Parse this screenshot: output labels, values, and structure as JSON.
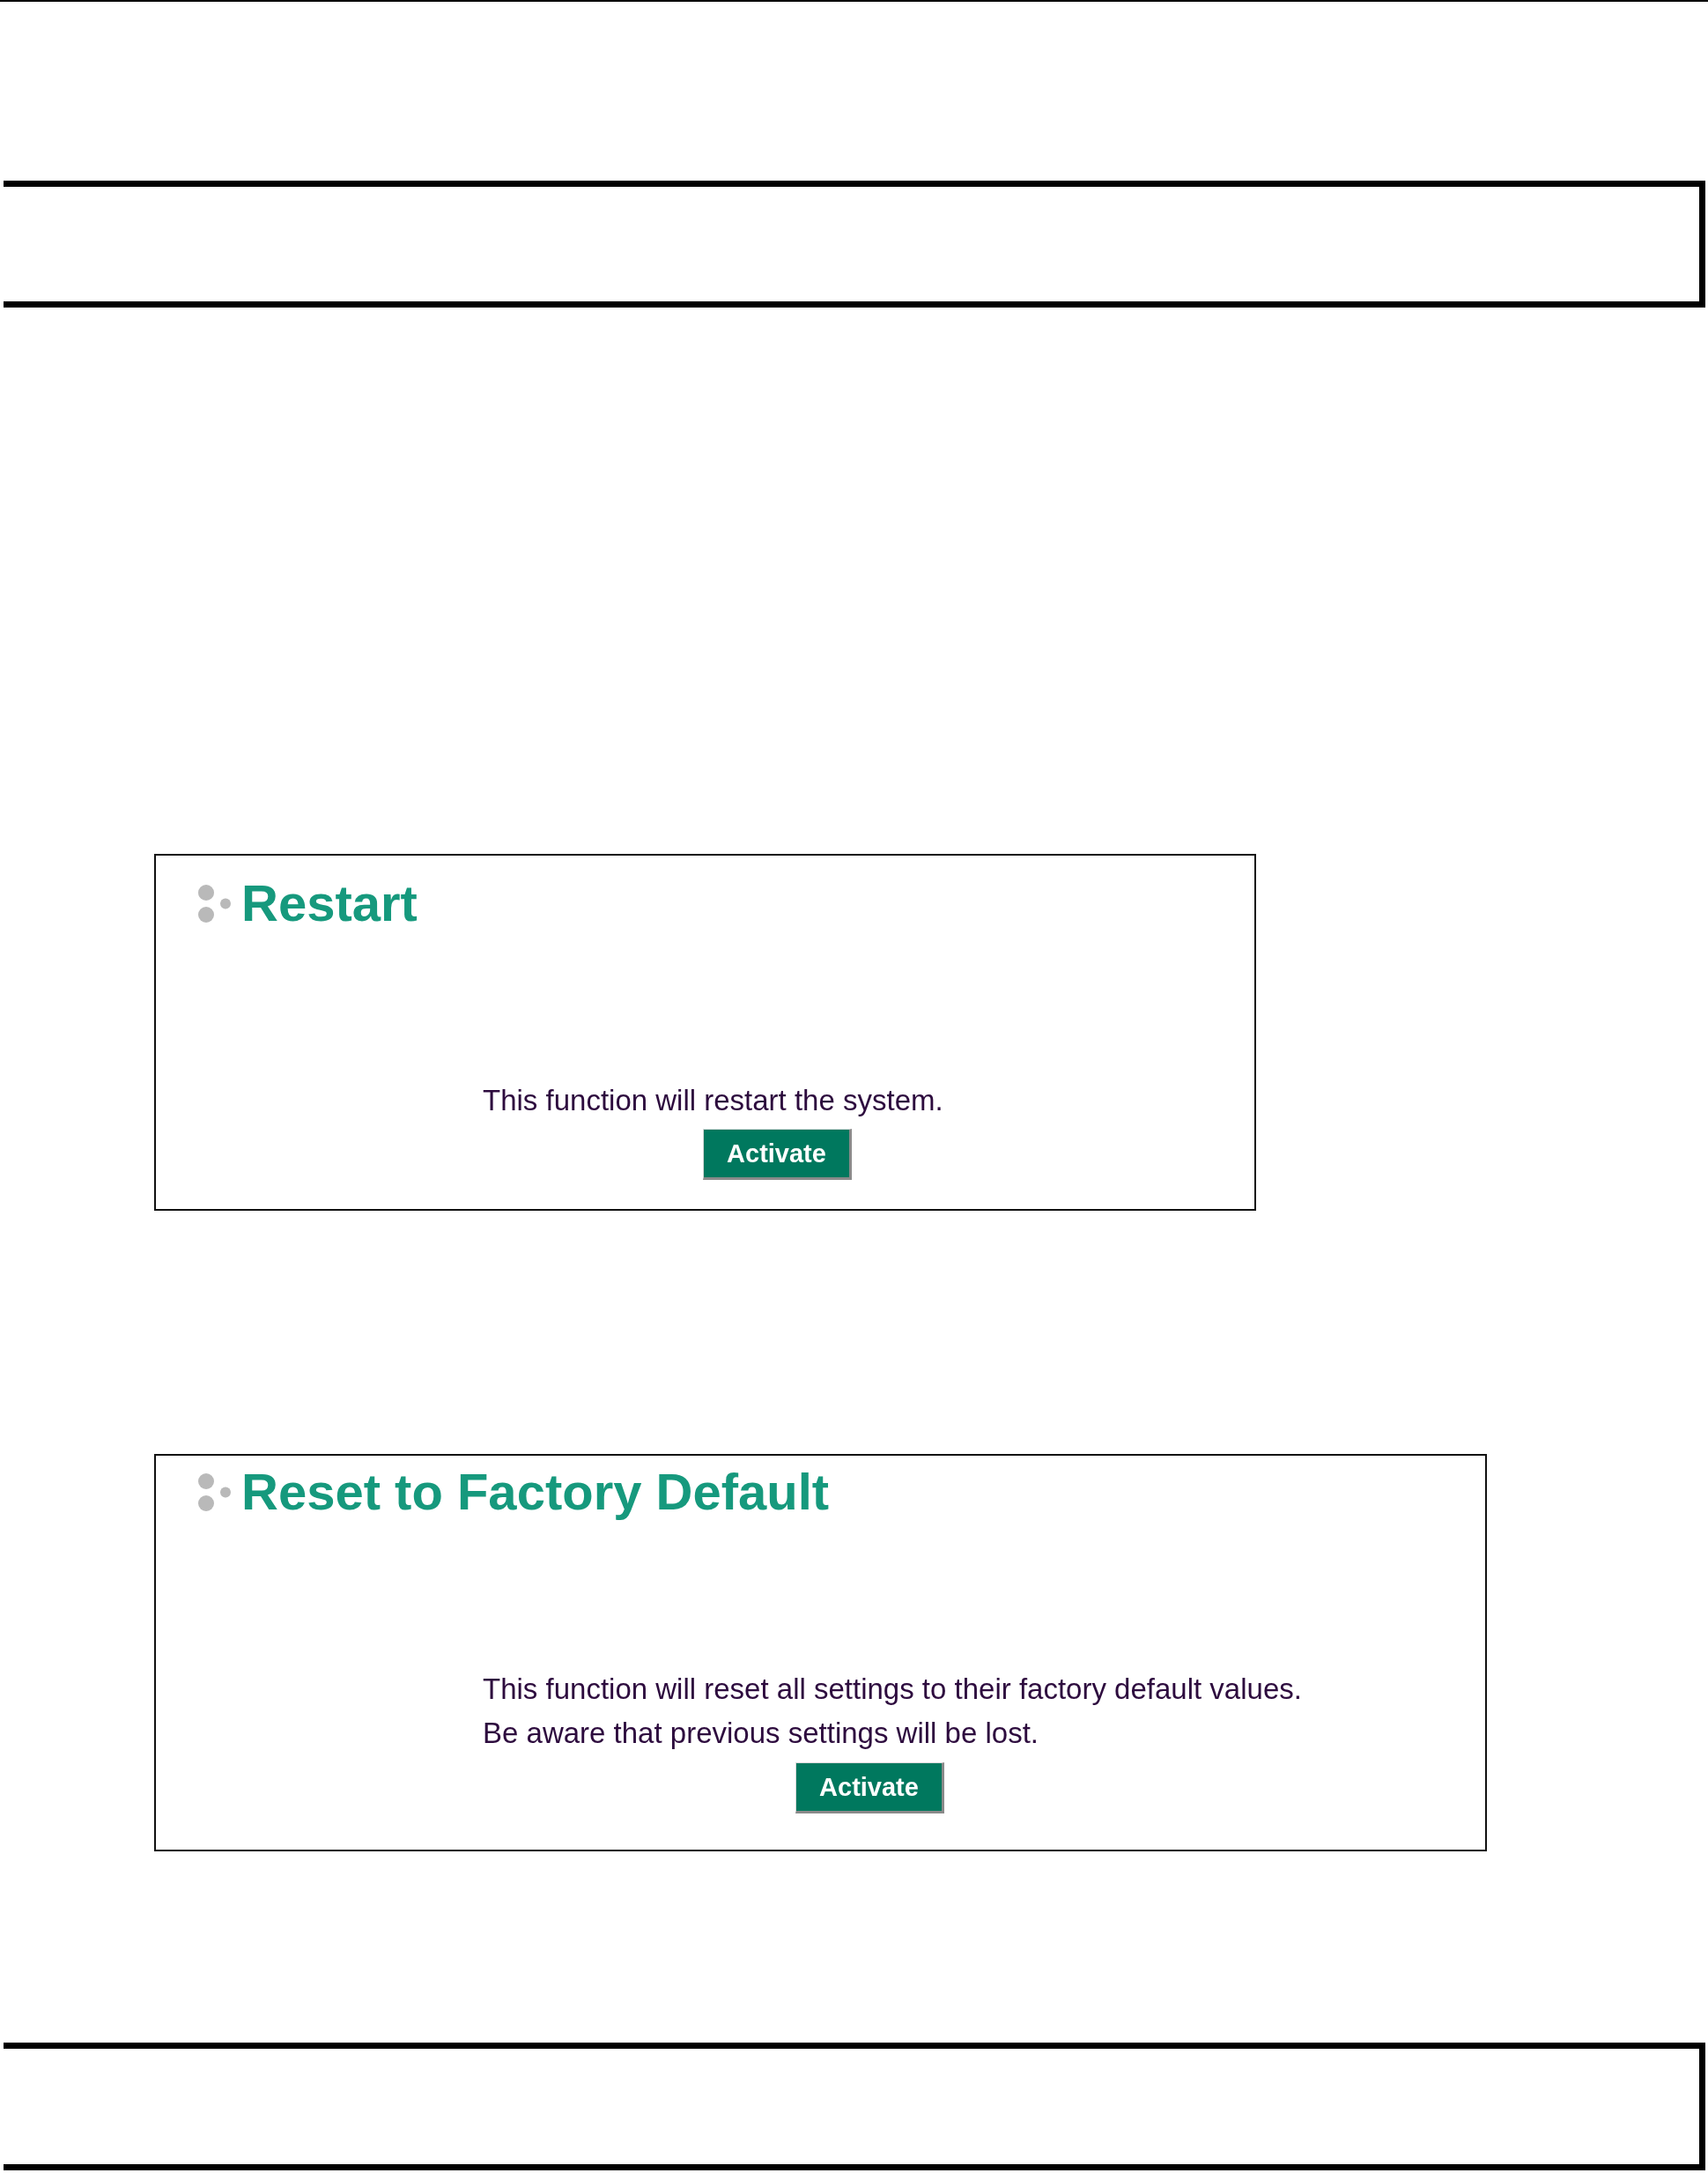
{
  "sections": [
    {
      "title": "Restart",
      "description": [
        "This function will restart the system."
      ],
      "button": "Activate"
    },
    {
      "title": "Reset to Factory Default",
      "description": [
        "This function will reset all settings to their factory default values.",
        "Be aware that previous settings will be lost."
      ],
      "button": "Activate"
    }
  ]
}
